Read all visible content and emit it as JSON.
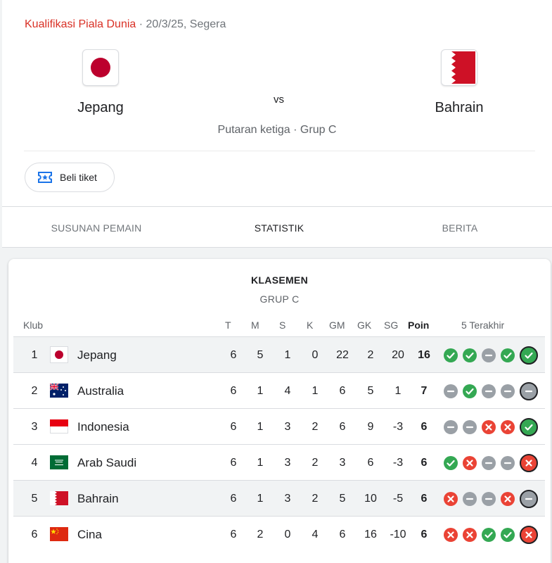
{
  "match": {
    "competition": "Kualifikasi Piala Dunia",
    "date_status": " · 20/3/25, Segera",
    "home": {
      "name": "Jepang",
      "flag": "japan-flag-icon"
    },
    "away": {
      "name": "Bahrain",
      "flag": "bahrain-flag-icon"
    },
    "vs": "vs",
    "round": "Putaran ketiga · Grup C"
  },
  "ticket": {
    "label": "Beli tiket",
    "icon": "ticket-icon"
  },
  "tabs": [
    {
      "label": "SUSUNAN PEMAIN",
      "active": false
    },
    {
      "label": "STATISTIK",
      "active": true
    },
    {
      "label": "BERITA",
      "active": false
    }
  ],
  "standings": {
    "title": "KLASEMEN",
    "group": "GRUP C",
    "headers": {
      "club": "Klub",
      "t": "T",
      "m": "M",
      "s": "S",
      "k": "K",
      "gm": "GM",
      "gk": "GK",
      "sg": "SG",
      "poin": "Poin",
      "form": "5 Terakhir"
    },
    "rows": [
      {
        "pos": "1",
        "club": "Jepang",
        "flag": "japan-flag-icon",
        "t": "6",
        "m": "5",
        "s": "1",
        "k": "0",
        "gm": "22",
        "gk": "2",
        "sg": "20",
        "poin": "16",
        "form": [
          "W",
          "W",
          "D",
          "W",
          "W"
        ],
        "highlight": true
      },
      {
        "pos": "2",
        "club": "Australia",
        "flag": "australia-flag-icon",
        "t": "6",
        "m": "1",
        "s": "4",
        "k": "1",
        "gm": "6",
        "gk": "5",
        "sg": "1",
        "poin": "7",
        "form": [
          "D",
          "W",
          "D",
          "D",
          "D"
        ],
        "highlight": false
      },
      {
        "pos": "3",
        "club": "Indonesia",
        "flag": "indonesia-flag-icon",
        "t": "6",
        "m": "1",
        "s": "3",
        "k": "2",
        "gm": "6",
        "gk": "9",
        "sg": "-3",
        "poin": "6",
        "form": [
          "D",
          "D",
          "L",
          "L",
          "W"
        ],
        "highlight": false
      },
      {
        "pos": "4",
        "club": "Arab Saudi",
        "flag": "saudi-arabia-flag-icon",
        "t": "6",
        "m": "1",
        "s": "3",
        "k": "2",
        "gm": "3",
        "gk": "6",
        "sg": "-3",
        "poin": "6",
        "form": [
          "W",
          "L",
          "D",
          "D",
          "L"
        ],
        "highlight": false
      },
      {
        "pos": "5",
        "club": "Bahrain",
        "flag": "bahrain-flag-icon",
        "t": "6",
        "m": "1",
        "s": "3",
        "k": "2",
        "gm": "5",
        "gk": "10",
        "sg": "-5",
        "poin": "6",
        "form": [
          "L",
          "D",
          "D",
          "L",
          "D"
        ],
        "highlight": true
      },
      {
        "pos": "6",
        "club": "Cina",
        "flag": "china-flag-icon",
        "t": "6",
        "m": "2",
        "s": "0",
        "k": "4",
        "gm": "6",
        "gk": "16",
        "sg": "-10",
        "poin": "6",
        "form": [
          "L",
          "L",
          "W",
          "W",
          "L"
        ],
        "highlight": false
      }
    ]
  },
  "colors": {
    "accent": "#1a73e8",
    "competition": "#d93025",
    "win": "#34a853",
    "loss": "#ea4335",
    "draw": "#9aa0a6"
  }
}
